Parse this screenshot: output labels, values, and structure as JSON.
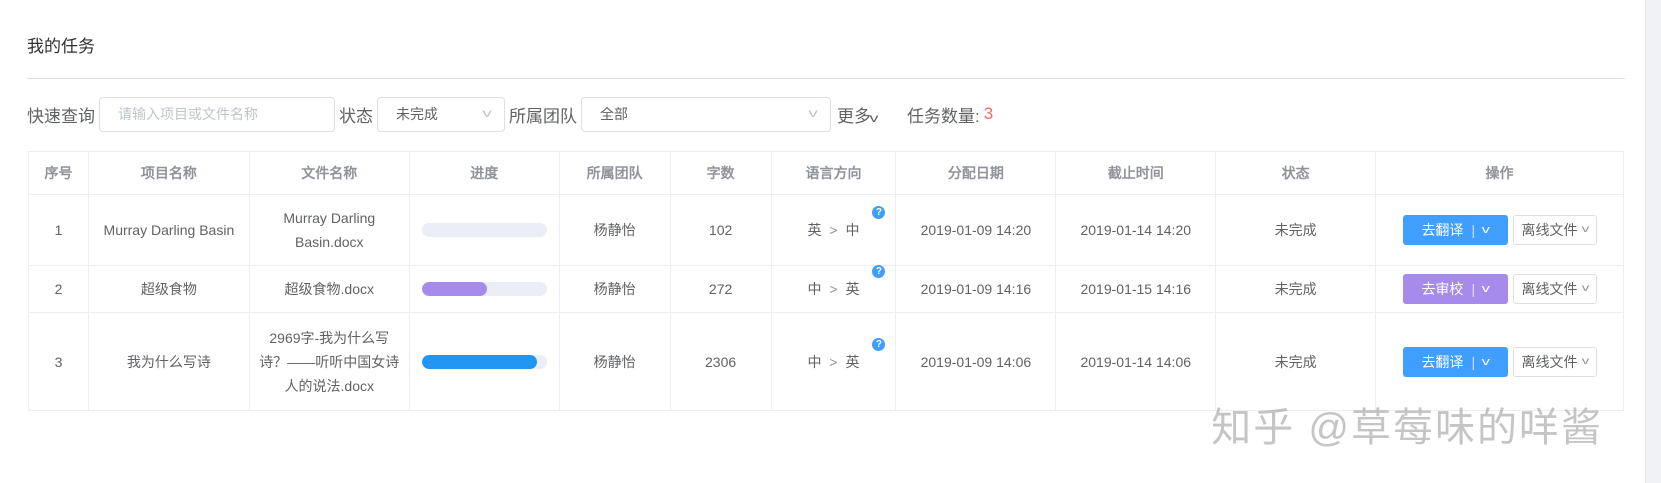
{
  "title": "我的任务",
  "filters": {
    "quick_label": "快速查询",
    "quick_placeholder": "请输入项目或文件名称",
    "status_label": "状态",
    "status_value": "未完成",
    "team_label": "所属团队",
    "team_value": "全部",
    "more_label": "更多",
    "count_label": "任务数量:",
    "count": "3"
  },
  "columns": [
    "序号",
    "项目名称",
    "文件名称",
    "进度",
    "所属团队",
    "字数",
    "语言方向",
    "分配日期",
    "截止时间",
    "状态",
    "操作"
  ],
  "rows": [
    {
      "no": "1",
      "project": "Murray Darling Basin",
      "file": "Murray Darling Basin.docx",
      "progress": 0,
      "progress_color": "#409eff",
      "team": "杨静怡",
      "words": "102",
      "lang_from": "英",
      "lang_to": "中",
      "assigned": "2019-01-09 14:20",
      "deadline": "2019-01-14 14:20",
      "status": "未完成",
      "action": "去翻译",
      "action_color": "#409eff",
      "offline": "离线文件"
    },
    {
      "no": "2",
      "project": "超级食物",
      "file": "超级食物.docx",
      "progress": 52,
      "progress_color": "#a68bec",
      "team": "杨静怡",
      "words": "272",
      "lang_from": "中",
      "lang_to": "英",
      "assigned": "2019-01-09 14:16",
      "deadline": "2019-01-15 14:16",
      "status": "未完成",
      "action": "去审校",
      "action_color": "#a68bec",
      "offline": "离线文件"
    },
    {
      "no": "3",
      "project": "我为什么写诗",
      "file": "2969字-我为什么写诗？——听听中国女诗人的说法.docx",
      "progress": 92,
      "progress_color": "#2196f3",
      "team": "杨静怡",
      "words": "2306",
      "lang_from": "中",
      "lang_to": "英",
      "assigned": "2019-01-09 14:06",
      "deadline": "2019-01-14 14:06",
      "status": "未完成",
      "action": "去翻译",
      "action_color": "#409eff",
      "offline": "离线文件"
    }
  ],
  "watermark": "知乎 @草莓味的咩酱"
}
